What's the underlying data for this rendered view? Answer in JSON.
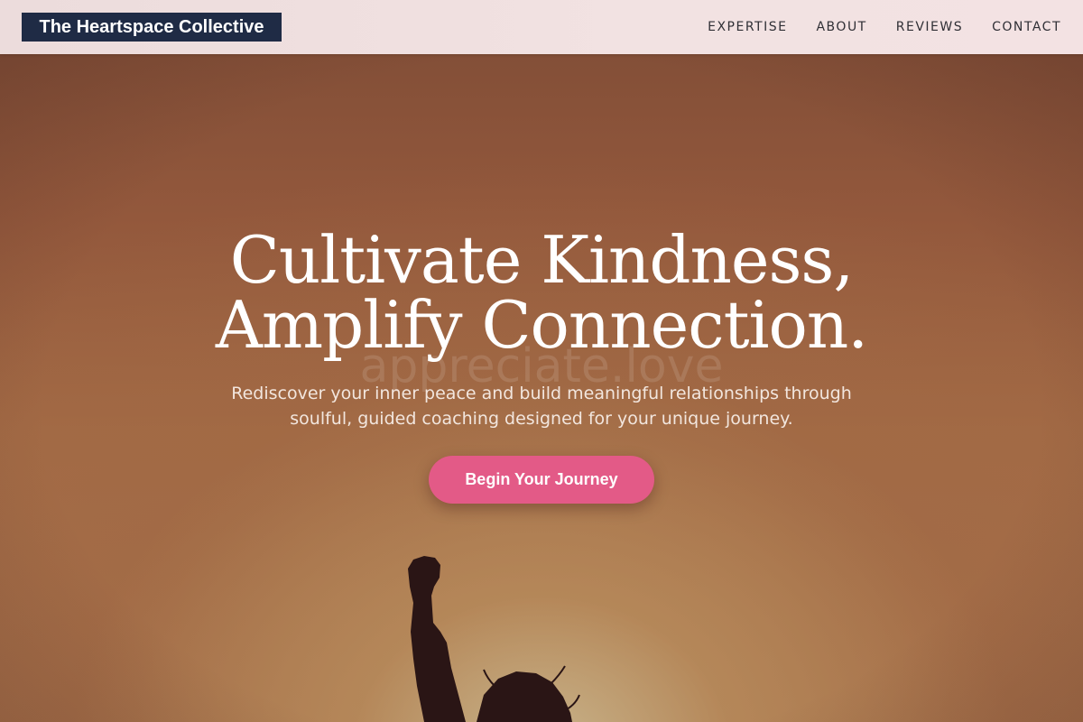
{
  "header": {
    "brand": "The Heartspace Collective",
    "nav": [
      {
        "label": "EXPERTISE"
      },
      {
        "label": "ABOUT"
      },
      {
        "label": "REVIEWS"
      },
      {
        "label": "CONTACT"
      }
    ]
  },
  "hero": {
    "headline_line1": "Cultivate Kindness,",
    "headline_line2": "Amplify Connection.",
    "watermark": "appreciate.love",
    "subtitle": "Rediscover your inner peace and build meaningful relationships through soulful, guided coaching designed for your unique journey.",
    "cta_label": "Begin Your Journey"
  },
  "colors": {
    "brand_bg": "#1f2b45",
    "cta": "#e35a87",
    "header_bg": "#f2e2e2"
  }
}
